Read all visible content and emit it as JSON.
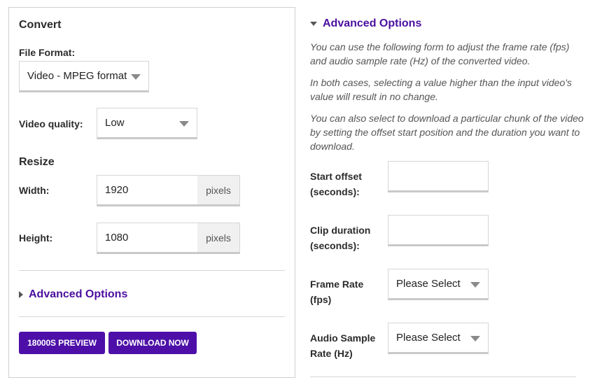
{
  "convert": {
    "title": "Convert",
    "file_format": {
      "label": "File Format:",
      "value": "Video - MPEG format"
    },
    "video_quality": {
      "label": "Video quality:",
      "value": "Low"
    },
    "resize": {
      "title": "Resize",
      "width": {
        "label": "Width:",
        "value": "1920",
        "unit": "pixels"
      },
      "height": {
        "label": "Height:",
        "value": "1080",
        "unit": "pixels"
      }
    },
    "advanced_toggle": "Advanced Options",
    "buttons": {
      "preview": "18000S PREVIEW",
      "download": "DOWNLOAD NOW"
    }
  },
  "advanced": {
    "title": "Advanced Options",
    "paragraphs": [
      "You can use the following form to adjust the frame rate (fps) and audio sample rate (Hz) of the converted video.",
      "In both cases, selecting a value higher than the input video's value will result in no change.",
      "You can also select to download a particular chunk of the video by setting the offset start position and the duration you want to download."
    ],
    "start_offset": {
      "label_line1": "Start offset",
      "label_line2": "(seconds):",
      "value": ""
    },
    "clip_duration": {
      "label_line1": "Clip duration",
      "label_line2": "(seconds):",
      "value": ""
    },
    "frame_rate": {
      "label_line1": "Frame Rate",
      "label_line2": "(fps)",
      "value": "Please Select"
    },
    "audio_sample_rate": {
      "label_line1": "Audio Sample",
      "label_line2": "Rate (Hz)",
      "value": "Please Select"
    }
  },
  "colors": {
    "accent": "#4d0fa8",
    "link": "#4b0f9f",
    "border": "#d6d6d6"
  }
}
